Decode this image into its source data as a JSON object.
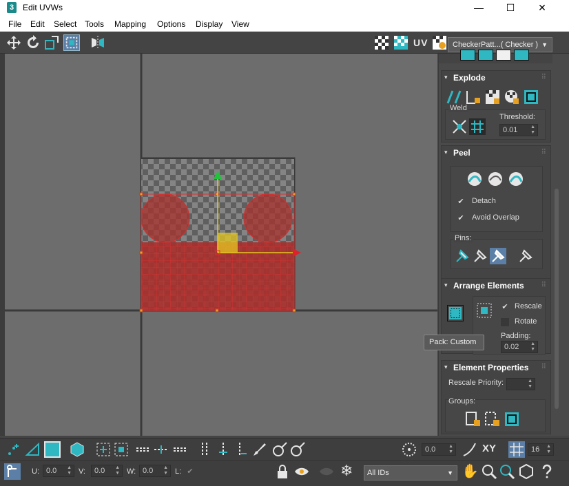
{
  "window": {
    "title": "Edit UVWs",
    "minimize": "—",
    "maximize": "☐",
    "close": "✕",
    "app_icon": "3"
  },
  "menu": [
    "File",
    "Edit",
    "Select",
    "Tools",
    "Mapping",
    "Options",
    "Display",
    "View"
  ],
  "toolbar": {
    "uv_label": "UV",
    "texture_dropdown": "CheckerPatt...( Checker )"
  },
  "explode": {
    "title": "Explode",
    "weld_label": "Weld",
    "threshold_label": "Threshold:",
    "threshold_value": "0.01"
  },
  "peel": {
    "title": "Peel",
    "detach_label": "Detach",
    "avoid_overlap_label": "Avoid Overlap",
    "pins_label": "Pins:"
  },
  "arrange": {
    "title": "Arrange Elements",
    "rescale_label": "Rescale",
    "rotate_label": "Rotate",
    "padding_label": "Padding:",
    "padding_value": "0.02",
    "tooltip": "Pack: Custom"
  },
  "element_props": {
    "title": "Element Properties",
    "rescale_priority_label": "Rescale Priority:",
    "groups_label": "Groups:"
  },
  "bottom1": {
    "angle_value": "0.0",
    "xy_label": "XY",
    "grid_value": "16"
  },
  "bottom2": {
    "u_label": "U:",
    "u_value": "0.0",
    "v_label": "V:",
    "v_value": "0.0",
    "w_label": "W:",
    "w_value": "0.0",
    "l_label": "L:",
    "ids_dropdown": "All IDs"
  },
  "colors": {
    "accent": "#2fb7c2",
    "selection": "#c0282a",
    "viewport": "#6d6d6d"
  }
}
